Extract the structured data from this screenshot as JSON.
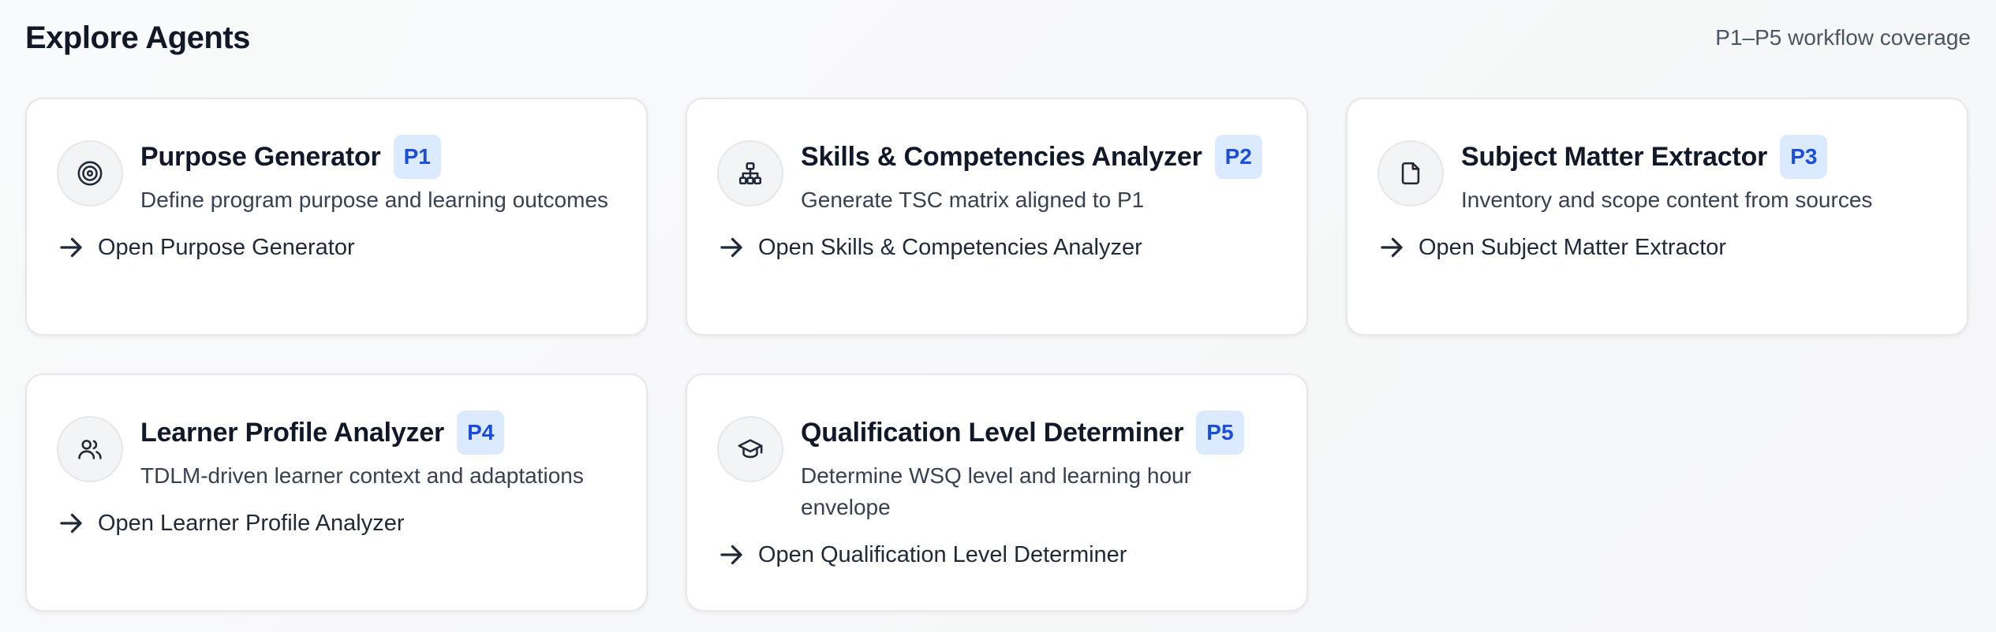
{
  "header": {
    "title": "Explore Agents",
    "coverage": "P1–P5 workflow coverage"
  },
  "agents": [
    {
      "name": "Purpose Generator",
      "badge": "P1",
      "icon": "target-icon",
      "description": "Define program purpose and learning outcomes",
      "action": "Open Purpose Generator"
    },
    {
      "name": "Skills & Competencies Analyzer",
      "badge": "P2",
      "icon": "hierarchy-icon",
      "description": "Generate TSC matrix aligned to P1",
      "action": "Open Skills & Competencies Analyzer"
    },
    {
      "name": "Subject Matter Extractor",
      "badge": "P3",
      "icon": "document-icon",
      "description": "Inventory and scope content from sources",
      "action": "Open Subject Matter Extractor"
    },
    {
      "name": "Learner Profile Analyzer",
      "badge": "P4",
      "icon": "users-icon",
      "description": "TDLM-driven learner context and adaptations",
      "action": "Open Learner Profile Analyzer"
    },
    {
      "name": "Qualification Level Determiner",
      "badge": "P5",
      "icon": "graduation-cap-icon",
      "description": "Determine WSQ level and learning hour envelope",
      "action": "Open Qualification Level Determiner"
    }
  ],
  "colors": {
    "badge_bg": "#dbeafe",
    "badge_text": "#1d4ed8",
    "text_primary": "#111827",
    "text_secondary": "#374151"
  }
}
